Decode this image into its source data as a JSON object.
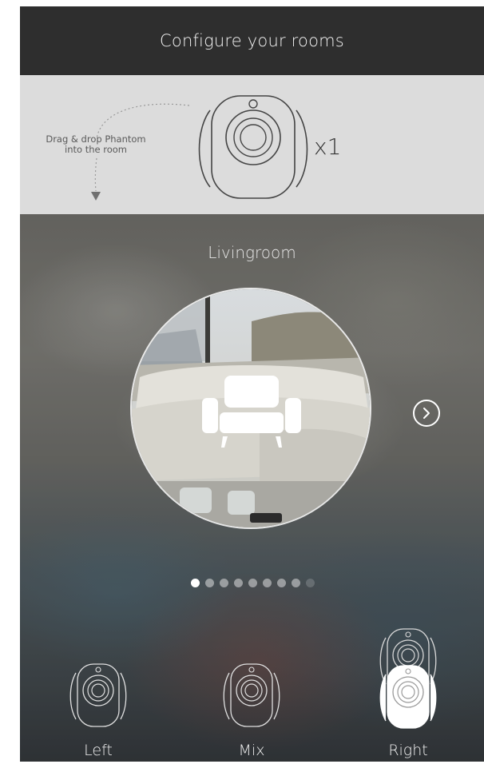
{
  "header": {
    "title": "Configure your rooms"
  },
  "drag_panel": {
    "hint_line1": "Drag & drop Phantom",
    "hint_line2": "into the room",
    "device_name": "Phantom speaker",
    "count": "x1"
  },
  "room": {
    "name": "Livingroom",
    "icon": "armchair-icon",
    "next_icon": "chevron-right-icon",
    "page_total": 9,
    "page_index": 1
  },
  "positions": [
    {
      "label": "Left",
      "state": "outline"
    },
    {
      "label": "Mix",
      "state": "outline"
    },
    {
      "label": "Right",
      "state": "filled"
    }
  ],
  "colors": {
    "header_bg": "#2e2e2e",
    "panel_bg": "#dcdcdc",
    "accent": "#ffffff"
  }
}
